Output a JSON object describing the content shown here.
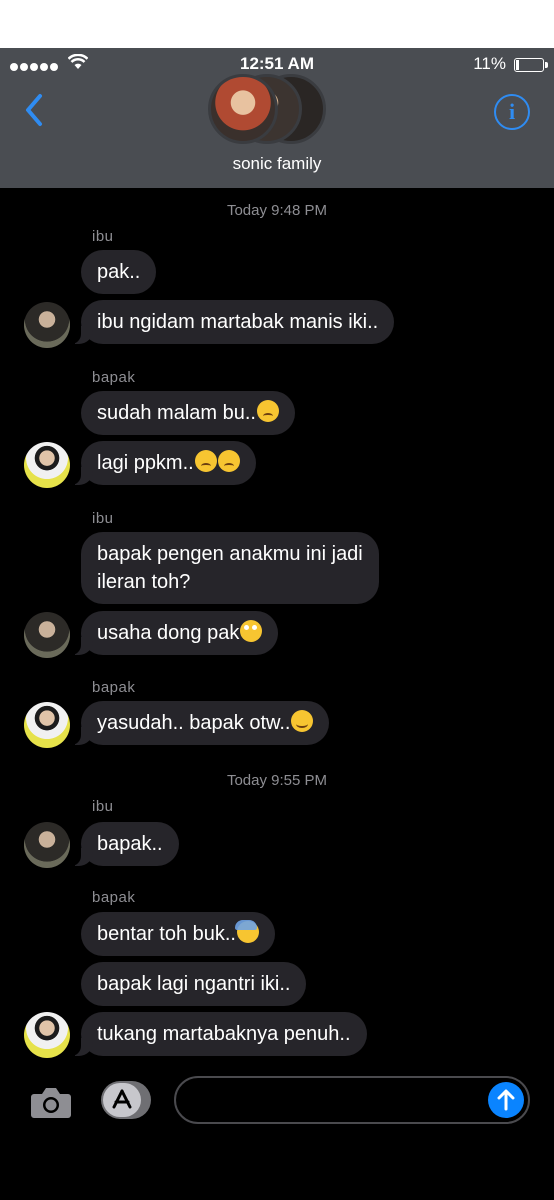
{
  "status_bar": {
    "time": "12:51 AM",
    "battery": "11%"
  },
  "header": {
    "group_name": "sonic family"
  },
  "conversation": {
    "timestamps": [
      "Today 9:48 PM",
      "Today 9:55 PM"
    ],
    "senders": [
      "ibu",
      "bapak",
      "ibu",
      "bapak",
      "ibu",
      "bapak"
    ],
    "messages": [
      "pak..",
      "ibu ngidam martabak manis iki..",
      "sudah malam bu..",
      "lagi ppkm..",
      "bapak pengen anakmu ini jadi",
      "ileran toh?",
      "usaha dong pak",
      "yasudah.. bapak otw..",
      "bapak..",
      "bentar toh buk..",
      "bapak lagi ngantri iki..",
      "tukang martabaknya penuh.."
    ]
  },
  "input": {
    "placeholder": ""
  },
  "colors": {
    "accent": "#2f8cf2",
    "bubble": "#26252a",
    "header": "#4a4d52"
  },
  "icons": [
    "back-chevron-icon",
    "info-icon",
    "camera-icon",
    "app-store-icon",
    "send-arrow-icon",
    "wifi-icon",
    "battery-icon"
  ]
}
